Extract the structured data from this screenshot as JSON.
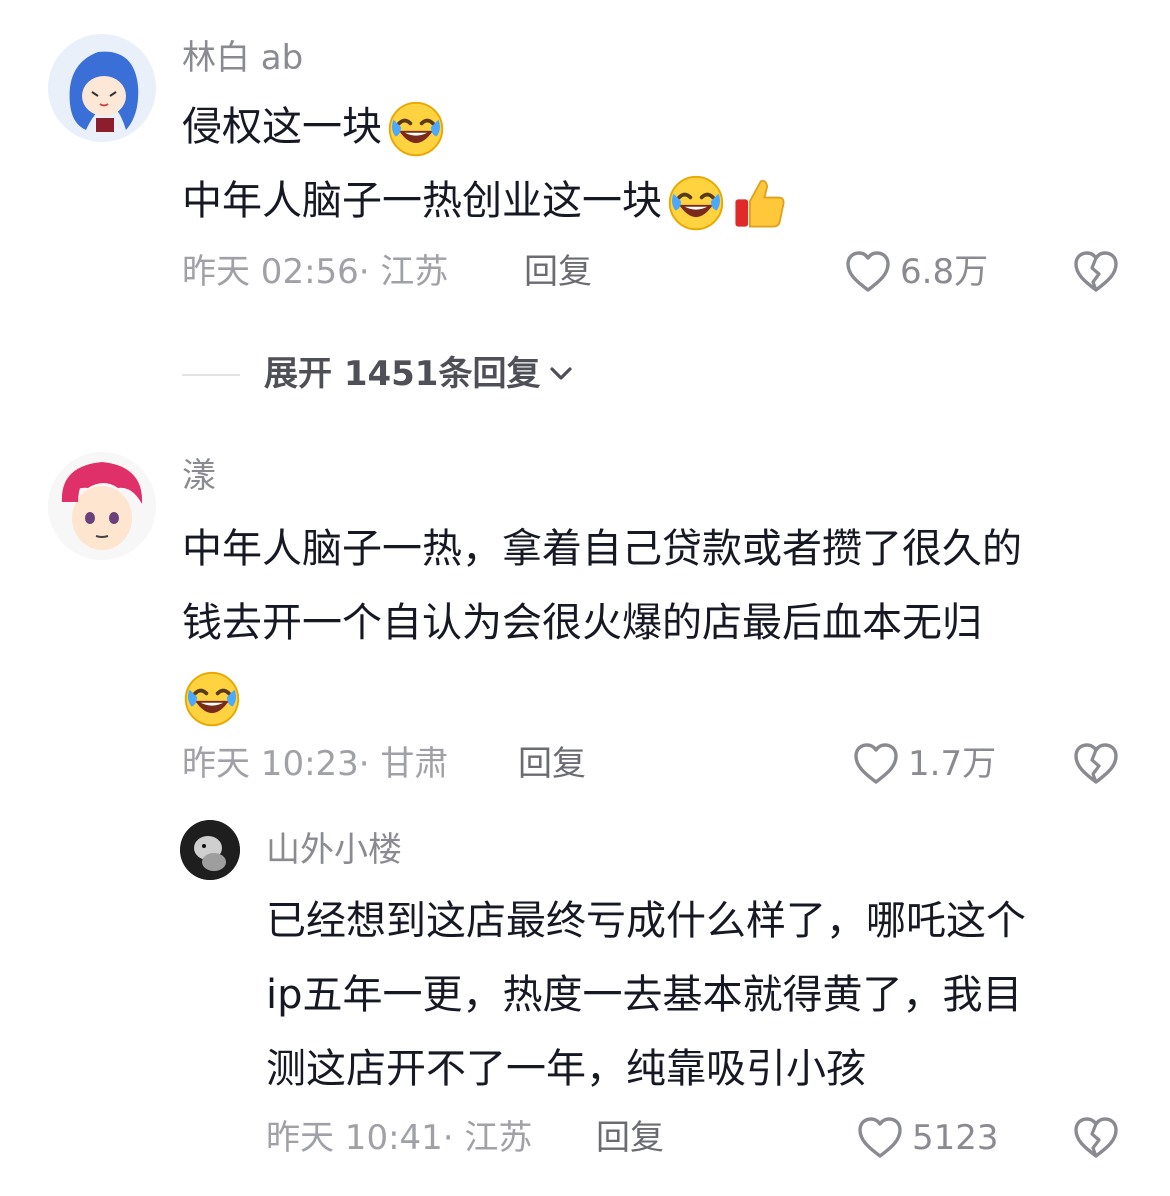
{
  "comments": [
    {
      "username": "林白 ab",
      "lines": [
        "侵权这一块",
        "中年人脑子一热创业这一块"
      ],
      "time_location": "昨天 02:56· 江苏",
      "reply_label": "回复",
      "likes": "6.8万",
      "expand_label": "展开 1451条回复"
    },
    {
      "username": "漾",
      "lines": [
        "中年人脑子一热，拿着自己贷款或者攒了很久的",
        "钱去开一个自认为会很火爆的店最后血本无归"
      ],
      "time_location": "昨天 10:23· 甘肃",
      "reply_label": "回复",
      "likes": "1.7万"
    },
    {
      "username": "山外小楼",
      "lines": [
        "已经想到这店最终亏成什么样了，哪吒这个",
        "ip五年一更，热度一去基本就得黄了，我目",
        "测这店开不了一年，纯靠吸引小孩"
      ],
      "time_location": "昨天 10:41· 江苏",
      "reply_label": "回复",
      "likes": "5123"
    }
  ],
  "icons": {
    "emoji_laugh": "rofl-emoji",
    "emoji_thumbs": "thumbs-up-emoji",
    "like": "heart-outline-icon",
    "dislike": "broken-heart-icon",
    "expand": "chevron-down-icon"
  }
}
